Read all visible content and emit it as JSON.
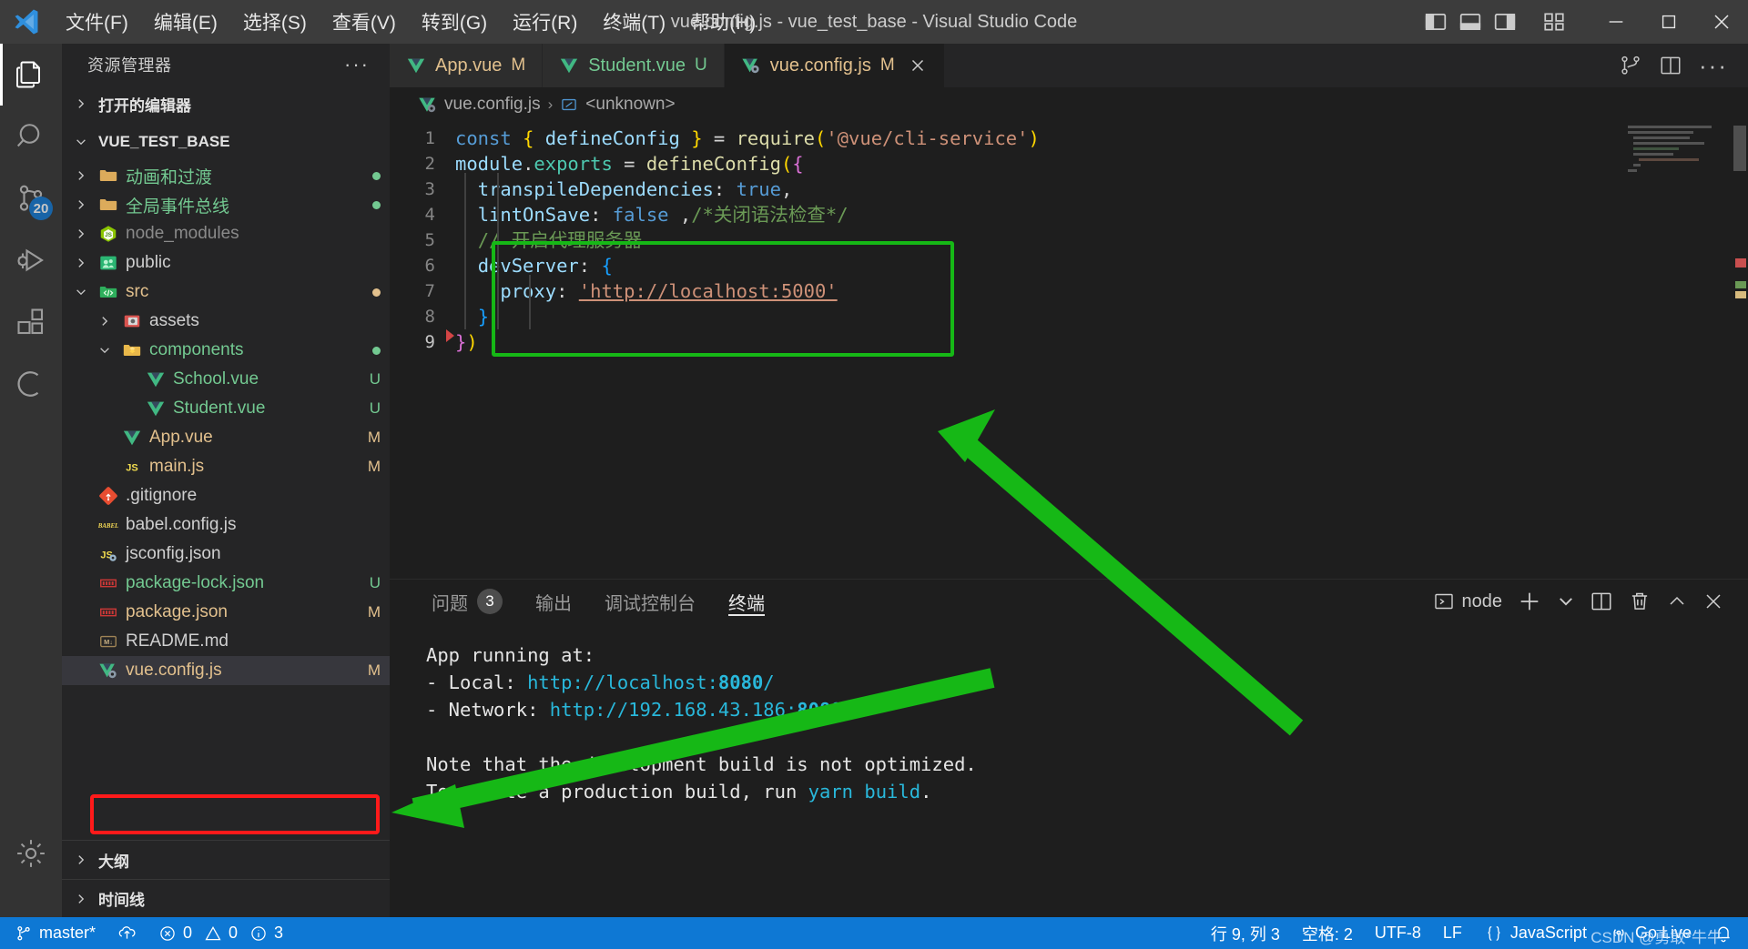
{
  "titlebar": {
    "menus": [
      {
        "label": "文件(F)",
        "mnemonic": "F"
      },
      {
        "label": "编辑(E)",
        "mnemonic": "E"
      },
      {
        "label": "选择(S)",
        "mnemonic": "S"
      },
      {
        "label": "查看(V)",
        "mnemonic": "V"
      },
      {
        "label": "转到(G)",
        "mnemonic": "G"
      },
      {
        "label": "运行(R)",
        "mnemonic": "R"
      },
      {
        "label": "终端(T)",
        "mnemonic": "T"
      },
      {
        "label": "帮助(H)",
        "mnemonic": "H"
      }
    ],
    "window_title": "vue.config.js - vue_test_base - Visual Studio Code",
    "layout_buttons": [
      "toggle-primary-sidebar",
      "toggle-panel",
      "toggle-secondary-sidebar",
      "customize-layout"
    ],
    "window_buttons": [
      "minimize",
      "maximize",
      "close"
    ]
  },
  "activitybar": {
    "items": [
      {
        "name": "explorer",
        "badge": ""
      },
      {
        "name": "search",
        "badge": ""
      },
      {
        "name": "source-control",
        "badge": "20"
      },
      {
        "name": "run-and-debug",
        "badge": ""
      },
      {
        "name": "extensions",
        "badge": ""
      },
      {
        "name": "remote-explorer",
        "badge": ""
      }
    ],
    "bottom": [
      {
        "name": "manage-settings"
      }
    ]
  },
  "sidebar": {
    "title": "资源管理器",
    "open_editors_label": "打开的编辑器",
    "project_label": "VUE_TEST_BASE",
    "outline_label": "大纲",
    "timeline_label": "时间线",
    "tree": [
      {
        "indent": 1,
        "twisty": "right",
        "icon": "folder",
        "name": "动画和过渡",
        "color": "green",
        "marker": "dot-green"
      },
      {
        "indent": 1,
        "twisty": "right",
        "icon": "folder",
        "name": "全局事件总线",
        "color": "green",
        "marker": "dot-green"
      },
      {
        "indent": 1,
        "twisty": "right",
        "icon": "node",
        "name": "node_modules",
        "color": "muted",
        "marker": ""
      },
      {
        "indent": 1,
        "twisty": "right",
        "icon": "public",
        "name": "public",
        "color": "default",
        "marker": ""
      },
      {
        "indent": 1,
        "twisty": "down",
        "icon": "src",
        "name": "src",
        "color": "orange",
        "marker": "dot-orange"
      },
      {
        "indent": 2,
        "twisty": "right",
        "icon": "assets",
        "name": "assets",
        "color": "default",
        "marker": ""
      },
      {
        "indent": 2,
        "twisty": "down",
        "icon": "comp",
        "name": "components",
        "color": "green",
        "marker": "dot-green"
      },
      {
        "indent": 3,
        "twisty": "none",
        "icon": "vue",
        "name": "School.vue",
        "color": "green",
        "marker": "U"
      },
      {
        "indent": 3,
        "twisty": "none",
        "icon": "vue",
        "name": "Student.vue",
        "color": "green",
        "marker": "U"
      },
      {
        "indent": 2,
        "twisty": "none",
        "icon": "vue",
        "name": "App.vue",
        "color": "orange",
        "marker": "M"
      },
      {
        "indent": 2,
        "twisty": "none",
        "icon": "js",
        "name": "main.js",
        "color": "orange",
        "marker": "M"
      },
      {
        "indent": 1,
        "twisty": "none",
        "icon": "git",
        "name": ".gitignore",
        "color": "default",
        "marker": ""
      },
      {
        "indent": 1,
        "twisty": "none",
        "icon": "babel",
        "name": "babel.config.js",
        "color": "default",
        "marker": ""
      },
      {
        "indent": 1,
        "twisty": "none",
        "icon": "jsconf",
        "name": "jsconfig.json",
        "color": "default",
        "marker": ""
      },
      {
        "indent": 1,
        "twisty": "none",
        "icon": "npm",
        "name": "package-lock.json",
        "color": "green",
        "marker": "U"
      },
      {
        "indent": 1,
        "twisty": "none",
        "icon": "npm",
        "name": "package.json",
        "color": "orange",
        "marker": "M"
      },
      {
        "indent": 1,
        "twisty": "none",
        "icon": "md",
        "name": "README.md",
        "color": "default",
        "marker": ""
      },
      {
        "indent": 1,
        "twisty": "none",
        "icon": "vueconf",
        "name": "vue.config.js",
        "color": "orange",
        "marker": "M",
        "selected": true
      }
    ]
  },
  "tabs": [
    {
      "name": "App.vue",
      "badge": "M",
      "color": "orange",
      "active": false,
      "icon": "vue"
    },
    {
      "name": "Student.vue",
      "badge": "U",
      "color": "green",
      "active": false,
      "icon": "vue"
    },
    {
      "name": "vue.config.js",
      "badge": "M",
      "color": "orange",
      "active": true,
      "icon": "vueconf"
    }
  ],
  "tabbar_actions": [
    "source-control-split-icon",
    "split-editor-icon",
    "more-actions-icon"
  ],
  "breadcrumb": {
    "file": "vue.config.js",
    "separator": "›",
    "symbol": "<unknown>"
  },
  "editor": {
    "language": "JavaScript",
    "lines": [
      {
        "n": "1",
        "tokens": [
          {
            "t": "const ",
            "c": "k-kw"
          },
          {
            "t": "{",
            "c": "k-b1"
          },
          {
            "t": " ",
            "c": "k-plain"
          },
          {
            "t": "defineConfig",
            "c": "k-var"
          },
          {
            "t": " ",
            "c": "k-plain"
          },
          {
            "t": "}",
            "c": "k-b1"
          },
          {
            "t": " = ",
            "c": "k-plain"
          },
          {
            "t": "require",
            "c": "k-fn"
          },
          {
            "t": "(",
            "c": "k-b1"
          },
          {
            "t": "'@vue/cli-service'",
            "c": "k-str"
          },
          {
            "t": ")",
            "c": "k-b1"
          }
        ]
      },
      {
        "n": "2",
        "tokens": [
          {
            "t": "module",
            "c": "k-var"
          },
          {
            "t": ".",
            "c": "k-plain"
          },
          {
            "t": "exports",
            "c": "k-exp"
          },
          {
            "t": " = ",
            "c": "k-plain"
          },
          {
            "t": "defineConfig",
            "c": "k-fn"
          },
          {
            "t": "(",
            "c": "k-b1"
          },
          {
            "t": "{",
            "c": "k-b2"
          }
        ]
      },
      {
        "n": "3",
        "tokens": [
          {
            "t": "  ",
            "c": "k-plain"
          },
          {
            "t": "transpileDependencies",
            "c": "k-prop"
          },
          {
            "t": ": ",
            "c": "k-plain"
          },
          {
            "t": "true",
            "c": "k-bool"
          },
          {
            "t": ",",
            "c": "k-plain"
          }
        ]
      },
      {
        "n": "4",
        "tokens": [
          {
            "t": "  ",
            "c": "k-plain"
          },
          {
            "t": "lintOnSave",
            "c": "k-prop"
          },
          {
            "t": ": ",
            "c": "k-plain"
          },
          {
            "t": "false",
            "c": "k-bool"
          },
          {
            "t": " ,",
            "c": "k-plain"
          },
          {
            "t": "/*关闭语法检查*/",
            "c": "k-com"
          }
        ]
      },
      {
        "n": "5",
        "tokens": [
          {
            "t": "  ",
            "c": "k-plain"
          },
          {
            "t": "// 开启代理服务器",
            "c": "k-com"
          }
        ]
      },
      {
        "n": "6",
        "tokens": [
          {
            "t": "  ",
            "c": "k-plain"
          },
          {
            "t": "devServer",
            "c": "k-prop"
          },
          {
            "t": ": ",
            "c": "k-plain"
          },
          {
            "t": "{",
            "c": "k-b3"
          }
        ]
      },
      {
        "n": "7",
        "tokens": [
          {
            "t": "    ",
            "c": "k-plain"
          },
          {
            "t": "proxy",
            "c": "k-prop"
          },
          {
            "t": ": ",
            "c": "k-plain"
          },
          {
            "t": "'http://localhost:5000'",
            "c": "k-str"
          }
        ]
      },
      {
        "n": "8",
        "tokens": [
          {
            "t": "  ",
            "c": "k-plain"
          },
          {
            "t": "}",
            "c": "k-b3"
          }
        ]
      },
      {
        "n": "9",
        "tokens": [
          {
            "t": "}",
            "c": "k-b2"
          },
          {
            "t": ")",
            "c": "k-b1"
          }
        ],
        "current": true
      }
    ]
  },
  "panel": {
    "tabs": [
      {
        "label": "问题",
        "badge": "3",
        "active": false
      },
      {
        "label": "输出",
        "badge": "",
        "active": false
      },
      {
        "label": "调试控制台",
        "badge": "",
        "active": false
      },
      {
        "label": "终端",
        "badge": "",
        "active": true
      }
    ],
    "actions": {
      "shell_label": "node",
      "new_terminal": "+",
      "dropdown": "⌄",
      "split": "split-terminal-icon",
      "kill": "trash-icon",
      "maximize": "chevron-up-icon",
      "close": "close-icon"
    },
    "terminal_lines": [
      [
        {
          "t": "  App running at:",
          "c": "t-white"
        }
      ],
      [
        {
          "t": "  - Local:   ",
          "c": "t-white"
        },
        {
          "t": "http://localhost:",
          "c": "t-cyan"
        },
        {
          "t": "8080",
          "c": "t-cyanb"
        },
        {
          "t": "/",
          "c": "t-cyan"
        }
      ],
      [
        {
          "t": "  - Network: ",
          "c": "t-white"
        },
        {
          "t": "http://192.168.43.186:",
          "c": "t-cyan"
        },
        {
          "t": "8080",
          "c": "t-cyanb"
        },
        {
          "t": "/",
          "c": "t-cyan"
        }
      ],
      [],
      [
        {
          "t": "  Note that the development build is not optimized.",
          "c": "t-white"
        }
      ],
      [
        {
          "t": "  To create a production build, run ",
          "c": "t-white"
        },
        {
          "t": "yarn build",
          "c": "t-cyan"
        },
        {
          "t": ".",
          "c": "t-white"
        }
      ]
    ]
  },
  "statusbar": {
    "branch": "master*",
    "sync_icon": "sync-cloud-icon",
    "errors": "0",
    "warnings": "0",
    "infos": "3",
    "cursor": "行 9, 列 3",
    "indent": "空格: 2",
    "encoding": "UTF-8",
    "eol": "LF",
    "language": "JavaScript",
    "go_live": "Go Live",
    "bell": "bell-icon",
    "watermark": "CSDN @勇敢*牛牛"
  },
  "colors": {
    "accent_blue": "#0e78d4",
    "annotation_green": "#16b816",
    "annotation_red": "#ff1a1a",
    "modified_orange": "#e2c08d",
    "untracked_green": "#73c991"
  }
}
